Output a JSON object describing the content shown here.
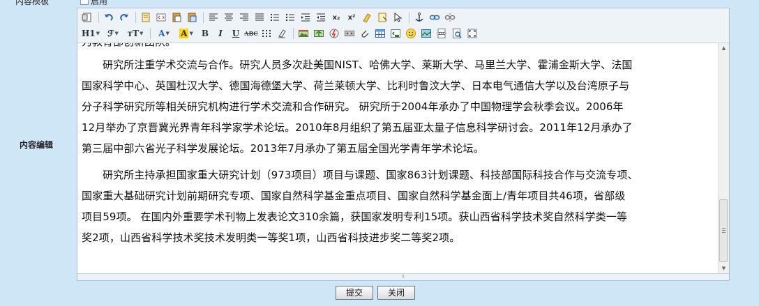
{
  "top_cut": {
    "label": "内容模板",
    "checkbox_label": "启用"
  },
  "form": {
    "row_label": "内容编辑"
  },
  "toolbar": {
    "row1": [
      {
        "name": "source-icon"
      },
      {
        "sep": true
      },
      {
        "name": "undo-icon"
      },
      {
        "name": "redo-icon"
      },
      {
        "sep": true
      },
      {
        "name": "template-icon"
      },
      {
        "name": "code-icon"
      },
      {
        "name": "paste-text-icon"
      },
      {
        "name": "paste-word-icon"
      },
      {
        "sep": true
      },
      {
        "name": "align-left-icon"
      },
      {
        "name": "align-center-icon"
      },
      {
        "name": "align-right-icon"
      },
      {
        "name": "align-justify-icon"
      },
      {
        "name": "ordered-list-icon"
      },
      {
        "name": "unordered-list-icon"
      },
      {
        "name": "indent-icon"
      },
      {
        "name": "outdent-icon"
      },
      {
        "name": "subscript-icon",
        "label": "x₂"
      },
      {
        "name": "superscript-icon",
        "label": "x²"
      },
      {
        "name": "clear-format-icon"
      },
      {
        "name": "select-all-icon"
      },
      {
        "name": "pointer-icon"
      },
      {
        "sep": true
      },
      {
        "name": "anchor-icon"
      },
      {
        "name": "link-icon"
      },
      {
        "name": "unlink-icon"
      }
    ],
    "row2": [
      {
        "name": "heading-dropdown",
        "label": "H1"
      },
      {
        "name": "font-family-dropdown",
        "label": "ℱ"
      },
      {
        "name": "font-size-dropdown",
        "label": "тT"
      },
      {
        "sep": true
      },
      {
        "name": "font-color-dropdown",
        "label": "A"
      },
      {
        "name": "highlight-dropdown",
        "label": "A"
      },
      {
        "name": "bold-button",
        "label": "B"
      },
      {
        "name": "italic-button",
        "label": "I"
      },
      {
        "name": "underline-button",
        "label": "U"
      },
      {
        "name": "strikethrough-button",
        "label": "ABC"
      },
      {
        "name": "line-height-icon"
      },
      {
        "name": "remove-format-icon"
      },
      {
        "sep": true
      },
      {
        "name": "image-icon"
      },
      {
        "name": "multi-image-icon"
      },
      {
        "name": "flash-icon"
      },
      {
        "name": "media-icon"
      },
      {
        "name": "attachment-icon"
      },
      {
        "name": "table-icon"
      },
      {
        "name": "insert-code-icon"
      },
      {
        "name": "emoticon-icon"
      },
      {
        "name": "map-icon"
      },
      {
        "name": "page-break-icon"
      },
      {
        "name": "preview-icon"
      },
      {
        "name": "fullscreen-icon"
      }
    ]
  },
  "content": {
    "partial_line": "为教育部创新团队。",
    "paragraphs": [
      [
        "研究所注重学术交流与合作。研究人员多次赴美国NIST、哈佛大学、莱斯大学、马里兰大学、霍浦金斯大学、法国",
        "国家科学中心、英国杜汉大学、德国海德堡大学、荷兰莱顿大学、比利时鲁汶大学、日本电气通信大学以及台湾原子与",
        "分子科学研究所等相关研究机构进行学术交流和合作研究。 研究所于2004年承办了中国物理学会秋季会议。2006年",
        "12月举办了京晋冀光界青年科学家学术论坛。2010年8月组织了第五届亚太量子信息科学研讨会。2011年12月承办了",
        "第三届中部六省光子科学发展论坛。2013年7月承办了第五届全国光学青年学术论坛。"
      ],
      [
        "研究所主持承担国家重大研究计划（973项目）项目与课题、国家863计划课题、科技部国际科技合作与交流专项、",
        "国家重大基础研究计划前期研究专项、国家自然科学基金重点项目、国家自然科学基金面上/青年项目共46项，省部级",
        "项目59项。 在国内外重要学术刊物上发表论文310余篇，获国家发明专利15项。获山西省科学技术奖自然科学类一等",
        "奖2项，山西省科学技术奖技术发明类一等奖1项，山西省科技进步奖二等奖2项。"
      ]
    ]
  },
  "buttons": {
    "submit": "提交",
    "close": "关闭"
  }
}
